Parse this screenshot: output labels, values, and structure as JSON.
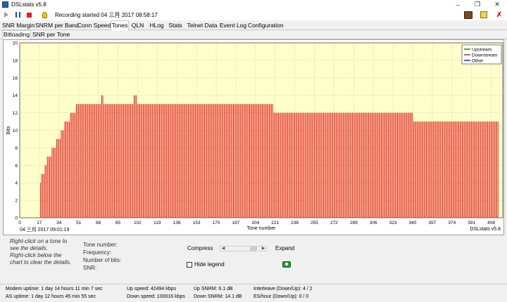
{
  "window": {
    "title": "DSLstats v5.8",
    "minimize_icon": "minimize-icon",
    "maximize_icon": "maximize-icon",
    "close_icon": "close-icon"
  },
  "toolbar": {
    "recording_text": "Recording started 04 三月 2017 08:58:17",
    "icons": [
      "play-icon",
      "pause-icon",
      "stop-icon",
      "bulb-icon",
      "tool-icon",
      "notes-icon",
      "exit-icon"
    ]
  },
  "tabs": [
    "SNR Margin",
    "SNRM per Band",
    "Conn Speed",
    "Tones",
    "QLN",
    "HLog",
    "Stats",
    "Telnet Data",
    "Event Log",
    "Configuration"
  ],
  "active_tab": "Tones",
  "subtabs": [
    "Bitloading",
    "SNR per Tone"
  ],
  "active_subtab": "Bitloading",
  "chart": {
    "footer_date": "04 三月 2017 09:01:19",
    "footer_version": "DSLstats v5.8"
  },
  "chart_data": {
    "type": "bar",
    "title": "",
    "xlabel": "Tone number",
    "ylabel": "Bits",
    "xlim": [
      0,
      418
    ],
    "ylim": [
      0,
      20
    ],
    "yticks": [
      0,
      2,
      4,
      6,
      8,
      10,
      12,
      14,
      16,
      18,
      20
    ],
    "xticks": [
      0,
      17,
      34,
      51,
      68,
      85,
      102,
      119,
      136,
      153,
      170,
      187,
      204,
      221,
      238,
      255,
      272,
      289,
      306,
      323,
      340,
      357,
      374,
      391,
      408
    ],
    "grid": true,
    "legend": {
      "placement": "top-right",
      "entries": [
        {
          "name": "Upstream",
          "color": "#1a8a1a"
        },
        {
          "name": "Downstream",
          "color": "#e02020"
        },
        {
          "name": "Other",
          "color": "#2020e0"
        }
      ]
    },
    "series": [
      {
        "name": "Downstream",
        "color": "#e02020",
        "segments": [
          {
            "from": 18,
            "to": 18,
            "bits": 4
          },
          {
            "from": 19,
            "to": 19,
            "bits": 5
          },
          {
            "from": 20,
            "to": 21,
            "bits": 5
          },
          {
            "from": 22,
            "to": 23,
            "bits": 6
          },
          {
            "from": 24,
            "to": 25,
            "bits": 7
          },
          {
            "from": 26,
            "to": 27,
            "bits": 7
          },
          {
            "from": 28,
            "to": 29,
            "bits": 8
          },
          {
            "from": 30,
            "to": 31,
            "bits": 8
          },
          {
            "from": 32,
            "to": 35,
            "bits": 9
          },
          {
            "from": 36,
            "to": 38,
            "bits": 10
          },
          {
            "from": 39,
            "to": 43,
            "bits": 11
          },
          {
            "from": 44,
            "to": 48,
            "bits": 12
          },
          {
            "from": 49,
            "to": 70,
            "bits": 13
          },
          {
            "from": 71,
            "to": 72,
            "bits": 14
          },
          {
            "from": 73,
            "to": 98,
            "bits": 13
          },
          {
            "from": 99,
            "to": 101,
            "bits": 14
          },
          {
            "from": 102,
            "to": 219,
            "bits": 13
          },
          {
            "from": 220,
            "to": 318,
            "bits": 12
          },
          {
            "from": 319,
            "to": 340,
            "bits": 12
          },
          {
            "from": 341,
            "to": 414,
            "bits": 11
          }
        ]
      }
    ]
  },
  "bottom": {
    "hint1": [
      "Right-click on a tone to",
      "see the details."
    ],
    "hint2": [
      "Right-click below the",
      "chart to clear the details."
    ],
    "tone_number": "Tone number:",
    "frequency": "Frequency:",
    "number_of_bits": "Number of bits:",
    "snr": "SNR:",
    "compress": "Compress",
    "expand": "Expand",
    "hide_legend": "Hide legend"
  },
  "status": {
    "modem_uptime": "Modem uptime: 1 day 14 hours 11 min 7 sec",
    "as_uptime": "AS uptime: 1 day 12 hours 45 min 55 sec",
    "up_speed": "Up speed: 42494 kbps",
    "down_speed": "Down speed: 100016 kbps",
    "up_snrm": "Up SNRM: 6.1 dB",
    "down_snrm": "Down SNRM: 14.1 dB",
    "interleave": "Interleave (Down/Up): 4 / 2",
    "es_hour": "ES/hour (Down/Up): 0 / 0"
  }
}
